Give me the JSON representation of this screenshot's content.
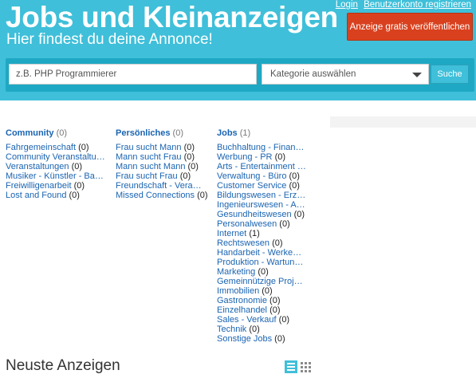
{
  "header": {
    "title": "Jobs und Kleinanzeigen",
    "subtitle": "Hier findest du deine Annonce!",
    "login_label": "Login",
    "register_label": "Benutzerkonto registrieren",
    "post_button_label": "Anzeige gratis veröffentlichen"
  },
  "search": {
    "placeholder": "z.B. PHP Programmierer",
    "category_label": "Kategorie auswählen",
    "button_label": "Suche"
  },
  "categories": [
    {
      "title": "Community",
      "count": "(0)",
      "items": [
        {
          "name": "Fahrgemeinschaft",
          "count": "(0)"
        },
        {
          "name": "Community Veranstaltungen",
          "count": "(0)"
        },
        {
          "name": "Veranstaltungen",
          "count": "(0)"
        },
        {
          "name": "Musiker - Künstler - Bands",
          "count": "(0)"
        },
        {
          "name": "Freiwilligenarbeit",
          "count": "(0)"
        },
        {
          "name": "Lost and Found",
          "count": "(0)"
        }
      ]
    },
    {
      "title": "Persönliches",
      "count": "(0)",
      "items": [
        {
          "name": "Frau sucht Mann",
          "count": "(0)"
        },
        {
          "name": "Mann sucht Frau",
          "count": "(0)"
        },
        {
          "name": "Mann sucht Mann",
          "count": "(0)"
        },
        {
          "name": "Frau sucht Frau",
          "count": "(0)"
        },
        {
          "name": "Freundschaft - Veranstaltungen",
          "count": "(0)"
        },
        {
          "name": "Missed Connections",
          "count": "(0)"
        }
      ]
    },
    {
      "title": "Jobs",
      "count": "(1)",
      "items": [
        {
          "name": "Buchhaltung - Finanzen",
          "count": "(0)"
        },
        {
          "name": "Werbung - PR",
          "count": "(0)"
        },
        {
          "name": "Arts - Entertainment - Medien",
          "count": "(0)"
        },
        {
          "name": "Verwaltung - Büro",
          "count": "(0)"
        },
        {
          "name": "Customer Service",
          "count": "(0)"
        },
        {
          "name": "Bildungswesen - Erziehung",
          "count": "(0)"
        },
        {
          "name": "Ingenieurswesen - Architektur",
          "count": "(0)"
        },
        {
          "name": "Gesundheitswesen",
          "count": "(0)"
        },
        {
          "name": "Personalwesen",
          "count": "(0)"
        },
        {
          "name": "Internet",
          "count": "(1)"
        },
        {
          "name": "Rechtswesen",
          "count": "(0)"
        },
        {
          "name": "Handarbeit - Werken - Bau",
          "count": "(0)"
        },
        {
          "name": "Produktion - Wartung - Logistik",
          "count": "(0)"
        },
        {
          "name": "Marketing",
          "count": "(0)"
        },
        {
          "name": "Gemeinnützige Projekte",
          "count": "(0)"
        },
        {
          "name": "Immobilien",
          "count": "(0)"
        },
        {
          "name": "Gastronomie",
          "count": "(0)"
        },
        {
          "name": "Einzelhandel",
          "count": "(0)"
        },
        {
          "name": "Sales - Verkauf",
          "count": "(0)"
        },
        {
          "name": "Technik",
          "count": "(0)"
        },
        {
          "name": "Sonstige Jobs",
          "count": "(0)"
        }
      ]
    }
  ],
  "latest": {
    "title": "Neuste Anzeigen",
    "list_view_icon": "list-view-icon",
    "grid_view_icon": "grid-view-icon"
  },
  "colors": {
    "header_bg": "#3fbfd9",
    "search_bar_bg": "#1ea8c4",
    "post_button_bg": "#d9411e",
    "link": "#1a64b2"
  }
}
